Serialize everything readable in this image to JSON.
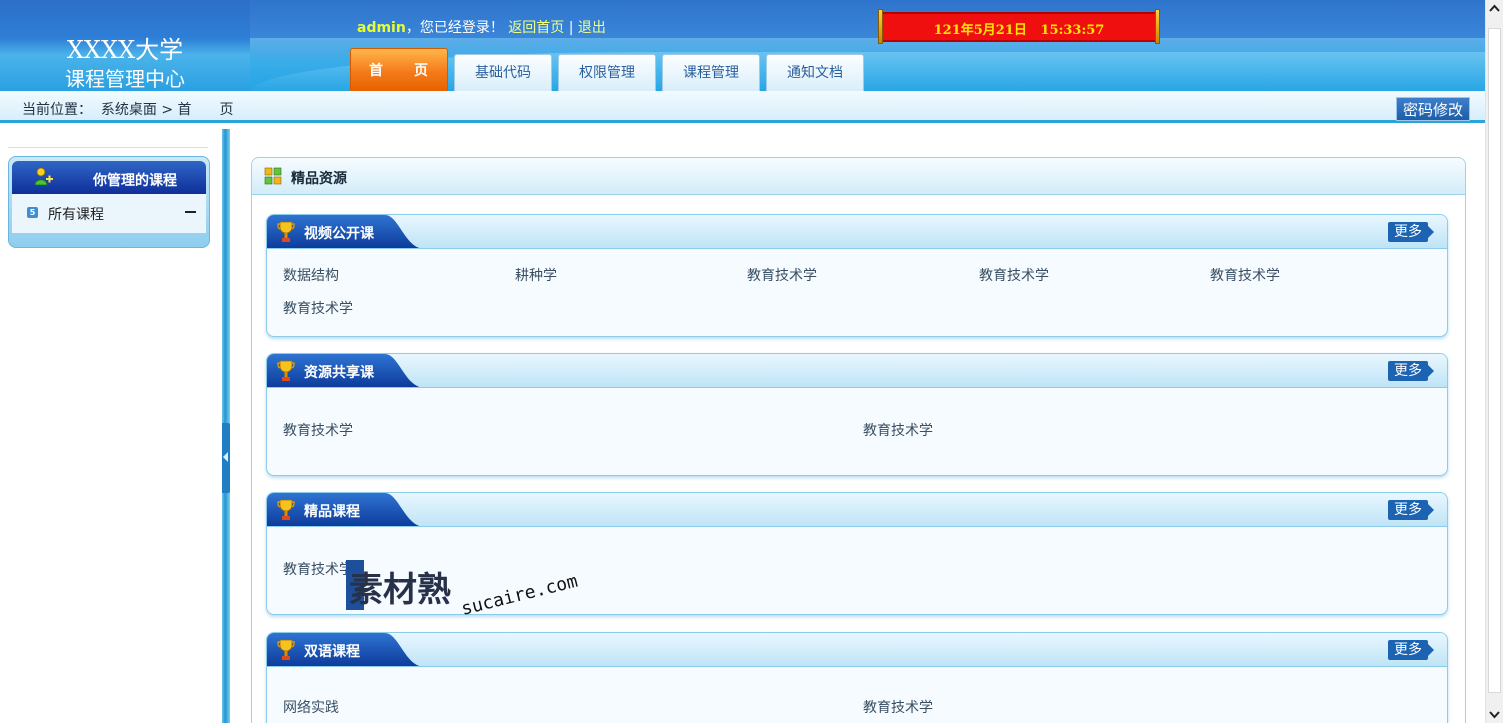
{
  "header": {
    "logo_line1": "XXXX大学",
    "logo_line2": "课程管理中心",
    "username": "admin",
    "login_msg": "，您已经登录！",
    "home_link": "返回首页",
    "separator": "|",
    "logout_link": "退出",
    "clock": "121年5月21日   15:33:57"
  },
  "tabs": [
    {
      "label": "首　　页",
      "active": true
    },
    {
      "label": "基础代码",
      "active": false
    },
    {
      "label": "权限管理",
      "active": false
    },
    {
      "label": "课程管理",
      "active": false
    },
    {
      "label": "通知文档",
      "active": false
    }
  ],
  "location": {
    "text": "当前位置：  系统桌面 > 首　　页",
    "password_button": "密码修改"
  },
  "sidebar": {
    "title": "你管理的课程",
    "item_badge": "5",
    "item_label": "所有课程"
  },
  "main": {
    "title": "精品资源",
    "sections": [
      {
        "title": "视频公开课",
        "more": "更多",
        "items": [
          "数据结构",
          "耕种学",
          "教育技术学",
          "教育技术学",
          "教育技术学",
          "教育技术学"
        ]
      },
      {
        "title": "资源共享课",
        "more": "更多",
        "items": [
          "教育技术学",
          "教育技术学"
        ]
      },
      {
        "title": "精品课程",
        "more": "更多",
        "items": [
          "教育技术学"
        ]
      },
      {
        "title": "双语课程",
        "more": "更多",
        "items": [
          "网络实践",
          "教育技术学"
        ]
      }
    ]
  },
  "watermark": {
    "cn": "素材熟",
    "en": "sucaire.com"
  },
  "colors": {
    "header_blue": "#2f74cc",
    "tab_orange": "#f47b1a",
    "clock_red": "#f00f0f",
    "section_title_blue": "#1c63b2"
  }
}
